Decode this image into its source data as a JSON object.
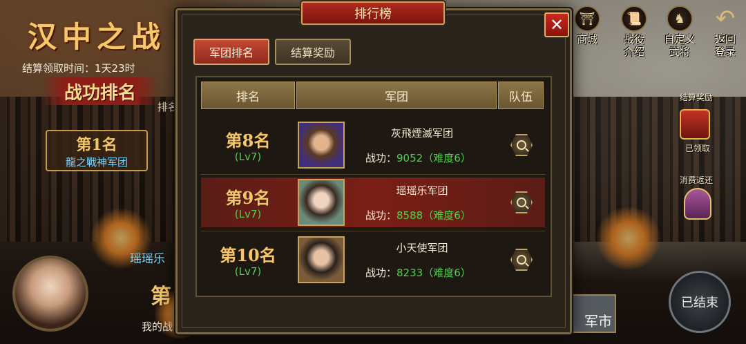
{
  "background": {
    "event_title": "汉中之战",
    "settle_time_label": "结算领取时间：1天23时",
    "merit_ranking_label": "战功排名",
    "ranking_tab_label": "排名",
    "first_place": {
      "rank": "第1名",
      "guild": "龍之戰神军团"
    },
    "my_guild": "瑶瑶乐",
    "my_rank": "第",
    "my_battle_label": "我的战"
  },
  "hud": {
    "shop": "商城",
    "campaign_line1": "战役",
    "campaign_line2": "介绍",
    "custom_line1": "自定义",
    "custom_line2": "武将",
    "return_line1": "返回",
    "return_line2": "登录",
    "settle_reward": "结算奖励",
    "claimed": "已领取",
    "spend_rebate": "消费返还",
    "ended": "已结束",
    "market": "军市"
  },
  "modal": {
    "title": "排行榜",
    "close": "✕",
    "tabs": [
      {
        "label": "军团排名",
        "active": true
      },
      {
        "label": "结算奖励",
        "active": false
      }
    ],
    "columns": {
      "rank": "排名",
      "guild": "军团",
      "team": "队伍"
    },
    "rows": [
      {
        "rank": "第8名",
        "level": "(Lv7)",
        "guild": "灰飛煙滅军团",
        "power_label": "战功：",
        "power": "9052（难度6）",
        "highlight": false
      },
      {
        "rank": "第9名",
        "level": "(Lv7)",
        "guild": "瑶瑶乐军团",
        "power_label": "战功：",
        "power": "8588（难度6）",
        "highlight": true
      },
      {
        "rank": "第10名",
        "level": "(Lv7)",
        "guild": "小天使军团",
        "power_label": "战功：",
        "power": "8233（难度6）",
        "highlight": false
      }
    ]
  },
  "icons": {
    "close": "close-icon",
    "search": "search-icon",
    "return": "return-arrow-icon"
  },
  "colors": {
    "gold": "#f2c66b",
    "level_green": "#4fd34a",
    "highlight_row": "#7a1e15",
    "title_red": "#b02a1f"
  }
}
